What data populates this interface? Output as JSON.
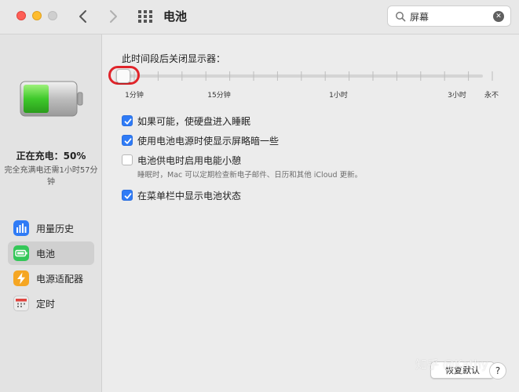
{
  "window": {
    "title": "电池",
    "search_value": "屏幕"
  },
  "sidebar": {
    "charge_status": "正在充电：50%",
    "charge_time": "完全充满电还需1小时57分钟",
    "battery_level": 0.5,
    "items": [
      {
        "label": "用量历史",
        "icon": "bar-chart-icon",
        "color": "#2f7bf6"
      },
      {
        "label": "电池",
        "icon": "battery-icon",
        "color": "#34c759",
        "selected": true
      },
      {
        "label": "电源适配器",
        "icon": "lightning-icon",
        "color": "#f5a623"
      },
      {
        "label": "定时",
        "icon": "calendar-icon",
        "color": "#e0e0e0"
      }
    ]
  },
  "display_off": {
    "label": "此时间段后关闭显示器：",
    "tick_labels": [
      "1分钟",
      "15分钟",
      "1小时",
      "3小时",
      "永不"
    ],
    "selected": "1分钟"
  },
  "options": [
    {
      "label": "如果可能，使硬盘进入睡眠",
      "checked": true,
      "description": ""
    },
    {
      "label": "使用电池电源时使显示屏略暗一些",
      "checked": true,
      "description": ""
    },
    {
      "label": "电池供电时启用电能小憩",
      "checked": false,
      "description": "睡眠时，Mac 可以定期检查新电子邮件、日历和其他 iCloud 更新。"
    },
    {
      "label": "在菜单栏中显示电池状态",
      "checked": true,
      "description": ""
    }
  ],
  "buttons": {
    "restore_defaults": "恢复默认",
    "help": "?"
  },
  "watermark": "知乎 @Kathy",
  "colors": {
    "accent": "#2f7bf6",
    "battery_green": "#34c759",
    "highlight_red": "#e0242a"
  }
}
